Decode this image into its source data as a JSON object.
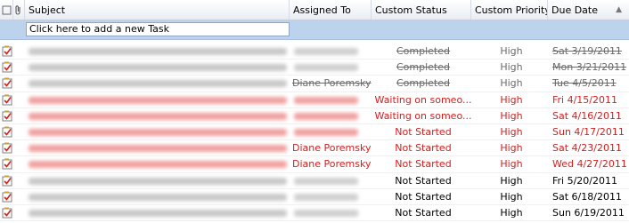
{
  "colors": {
    "normal_text": "#000000",
    "overdue_text": "#d21f1f",
    "completed_text": "#6a6a6a",
    "header_bg": "#f1f3f7",
    "new_row_bg": "#bcd3ee"
  },
  "header": {
    "subject": "Subject",
    "assigned_to": "Assigned To",
    "custom_status": "Custom Status",
    "custom_priority": "Custom Priority",
    "due_date": "Due Date"
  },
  "new_task_placeholder": "Click here to add a new Task",
  "tasks": [
    {
      "assigned_to": "",
      "status": "Completed",
      "priority": "High",
      "due": "Sat 3/19/2011",
      "state": "completed"
    },
    {
      "assigned_to": "",
      "status": "Completed",
      "priority": "High",
      "due": "Mon 3/21/2011",
      "state": "completed"
    },
    {
      "assigned_to": "Diane Poremsky",
      "status": "Completed",
      "priority": "High",
      "due": "Tue 4/5/2011",
      "state": "completed"
    },
    {
      "assigned_to": "",
      "status": "Waiting on someo...",
      "priority": "High",
      "due": "Fri 4/15/2011",
      "state": "overdue"
    },
    {
      "assigned_to": "",
      "status": "Waiting on someo...",
      "priority": "High",
      "due": "Sat 4/16/2011",
      "state": "overdue"
    },
    {
      "assigned_to": "",
      "status": "Not Started",
      "priority": "High",
      "due": "Sun 4/17/2011",
      "state": "overdue"
    },
    {
      "assigned_to": "Diane Poremsky",
      "status": "Not Started",
      "priority": "High",
      "due": "Sat 4/23/2011",
      "state": "overdue"
    },
    {
      "assigned_to": "Diane Poremsky",
      "status": "Not Started",
      "priority": "High",
      "due": "Wed 4/27/2011",
      "state": "overdue"
    },
    {
      "assigned_to": "",
      "status": "Not Started",
      "priority": "High",
      "due": "Fri 5/20/2011",
      "state": "normal"
    },
    {
      "assigned_to": "",
      "status": "Not Started",
      "priority": "High",
      "due": "Sat 6/18/2011",
      "state": "normal"
    },
    {
      "assigned_to": "",
      "status": "Not Started",
      "priority": "High",
      "due": "Sun 6/19/2011",
      "state": "normal"
    }
  ]
}
